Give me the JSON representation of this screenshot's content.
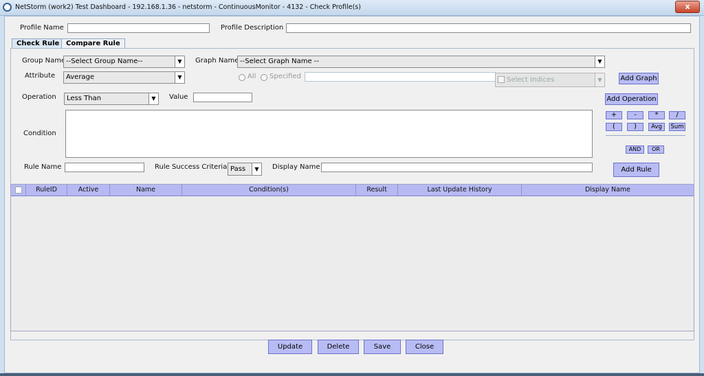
{
  "window": {
    "title": "NetStorm (work2) Test Dashboard - 192.168.1.36 - netstorm - ContinuousMonitor - 4132 - Check Profile(s)",
    "close_label": "x"
  },
  "profile": {
    "name_label": "Profile Name",
    "name_value": "",
    "description_label": "Profile Description",
    "description_value": ""
  },
  "tabs": [
    {
      "label": "Check Rule",
      "active": true
    },
    {
      "label": "Compare Rule",
      "active": false
    }
  ],
  "form": {
    "group_name_label": "Group Name",
    "group_name_value": "--Select Group Name--",
    "graph_name_label": "Graph Name",
    "graph_name_value": "--Select Graph Name --",
    "attribute_label": "Attribute",
    "attribute_value": "Average",
    "radio_all": "All",
    "radio_specified": "Specified",
    "indices_placeholder": "Select Indices",
    "add_graph": "Add Graph",
    "operation_label": "Operation",
    "operation_value": "Less Than",
    "value_label": "Value",
    "value_value": "",
    "add_operation": "Add Operation",
    "operators": [
      "+",
      "-",
      "*",
      "/",
      "(",
      ")",
      "Avg",
      "Sum"
    ],
    "logic": [
      "AND",
      "OR"
    ],
    "condition_label": "Condition",
    "rule_name_label": "Rule Name",
    "rule_success_label": "Rule Success Criteria",
    "rule_success_value": "Pass",
    "display_name_label": "Display Name",
    "add_rule": "Add Rule"
  },
  "table": {
    "columns": [
      "RuleID",
      "Active",
      "Name",
      "Condition(s)",
      "Result",
      "Last Update History",
      "Display Name"
    ]
  },
  "footer": {
    "update": "Update",
    "delete": "Delete",
    "save": "Save",
    "close": "Close"
  },
  "colors": {
    "button_fill": "#b8bcf4",
    "header_fill": "#b6b9f2",
    "titlebar": "#c3d7ec"
  }
}
